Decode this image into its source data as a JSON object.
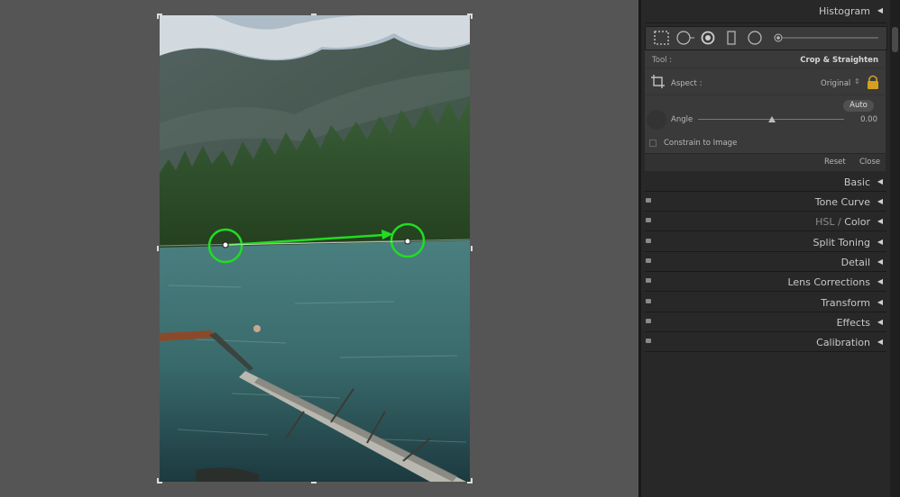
{
  "panel": {
    "histogram": {
      "label": "Histogram"
    },
    "toolstrip": {
      "icons": [
        "crop-overlay-icon",
        "spot-removal-icon",
        "red-eye-icon",
        "graduated-filter-icon",
        "radial-filter-icon",
        "adjustment-brush-icon"
      ]
    },
    "crop": {
      "tool_label": "Tool :",
      "tool_value": "Crop & Straighten",
      "aspect_label": "Aspect :",
      "aspect_value": "Original",
      "auto_label": "Auto",
      "angle_label": "Angle",
      "angle_value": "0.00",
      "constrain_label": "Constrain to Image",
      "reset_label": "Reset",
      "close_label": "Close"
    },
    "sections": {
      "basic": "Basic",
      "tone_curve": "Tone Curve",
      "hsl": "HSL",
      "hsl_sep": "/",
      "color": "Color",
      "split_toning": "Split Toning",
      "detail": "Detail",
      "lens_corrections": "Lens Corrections",
      "transform": "Transform",
      "effects": "Effects",
      "calibration": "Calibration"
    },
    "collapse_glyph": "◀"
  },
  "colors": {
    "straighten_guide": "#22dd22",
    "lock_icon": "#d4a020"
  }
}
